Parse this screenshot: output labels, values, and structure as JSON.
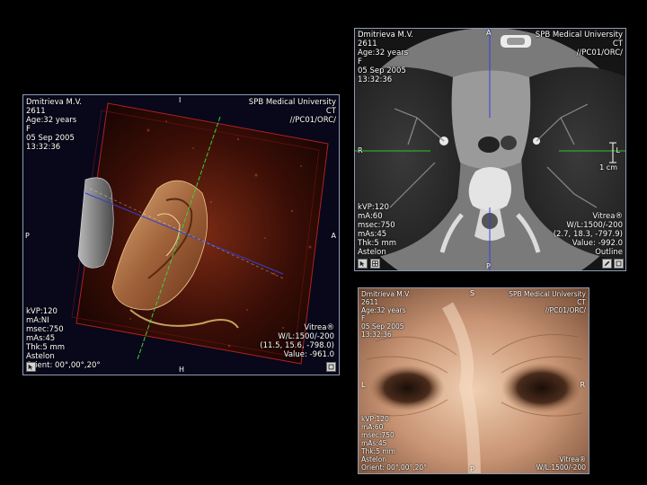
{
  "views": {
    "volume": {
      "top_left": [
        "Dmitrieva M.V.",
        "2611",
        "Age:32 years",
        "F",
        "05 Sep 2005",
        "13:32:36"
      ],
      "top_right": [
        "SPB Medical University",
        "CT",
        "//PC01/ORC/"
      ],
      "bottom_left": [
        "kVP:120",
        "mA:NI",
        "msec:750",
        "mAs:45",
        "Thk:5 mm",
        "Astelon",
        "Orient: 00°,00°,20°"
      ],
      "bottom_right": [
        "Vitrea®",
        "W/L:1500/-200",
        "(11.5, 15.6, -798.0)",
        "Value: -961.0"
      ],
      "markers": {
        "top": "I",
        "bottom": "H",
        "left": "P",
        "right": "A"
      }
    },
    "axial": {
      "top_left": [
        "Dmitrieva M.V.",
        "2611",
        "Age:32 years",
        "F",
        "05 Sep 2005",
        "13:32:36"
      ],
      "top_right": [
        "SPB Medical University",
        "CT",
        "//PC01/ORC/"
      ],
      "bottom_left": [
        "kVP:120",
        "mA:60",
        "msec:750",
        "mAs:45",
        "Thk:5 mm",
        "Astelon"
      ],
      "bottom_right": [
        "Vitrea®",
        "W/L:1500/-200",
        "(2.7, 18.3, -797.9)",
        "Value: -992.0",
        "Outline"
      ],
      "markers": {
        "top": "A",
        "bottom": "P",
        "left": "R",
        "right": "L"
      },
      "scale": "1 cm"
    },
    "endo": {
      "top_left": [
        "Dmitrieva M.V.",
        "2611",
        "Age:32 years",
        "F",
        "05 Sep 2005",
        "13:32:36"
      ],
      "top_right": [
        "SPB Medical University",
        "CT",
        "//PC01/ORC/"
      ],
      "bottom_left": [
        "kVP:120",
        "mA:60",
        "msec:750",
        "mAs:45",
        "Thk:5 mm",
        "Astelon",
        "Orient: 00°,00°,20°"
      ],
      "bottom_right": [
        "Vitrea®",
        "W/L:1500/-200"
      ],
      "markers": {
        "top": "S",
        "bottom": "P",
        "left": "L",
        "right": "R"
      }
    }
  }
}
